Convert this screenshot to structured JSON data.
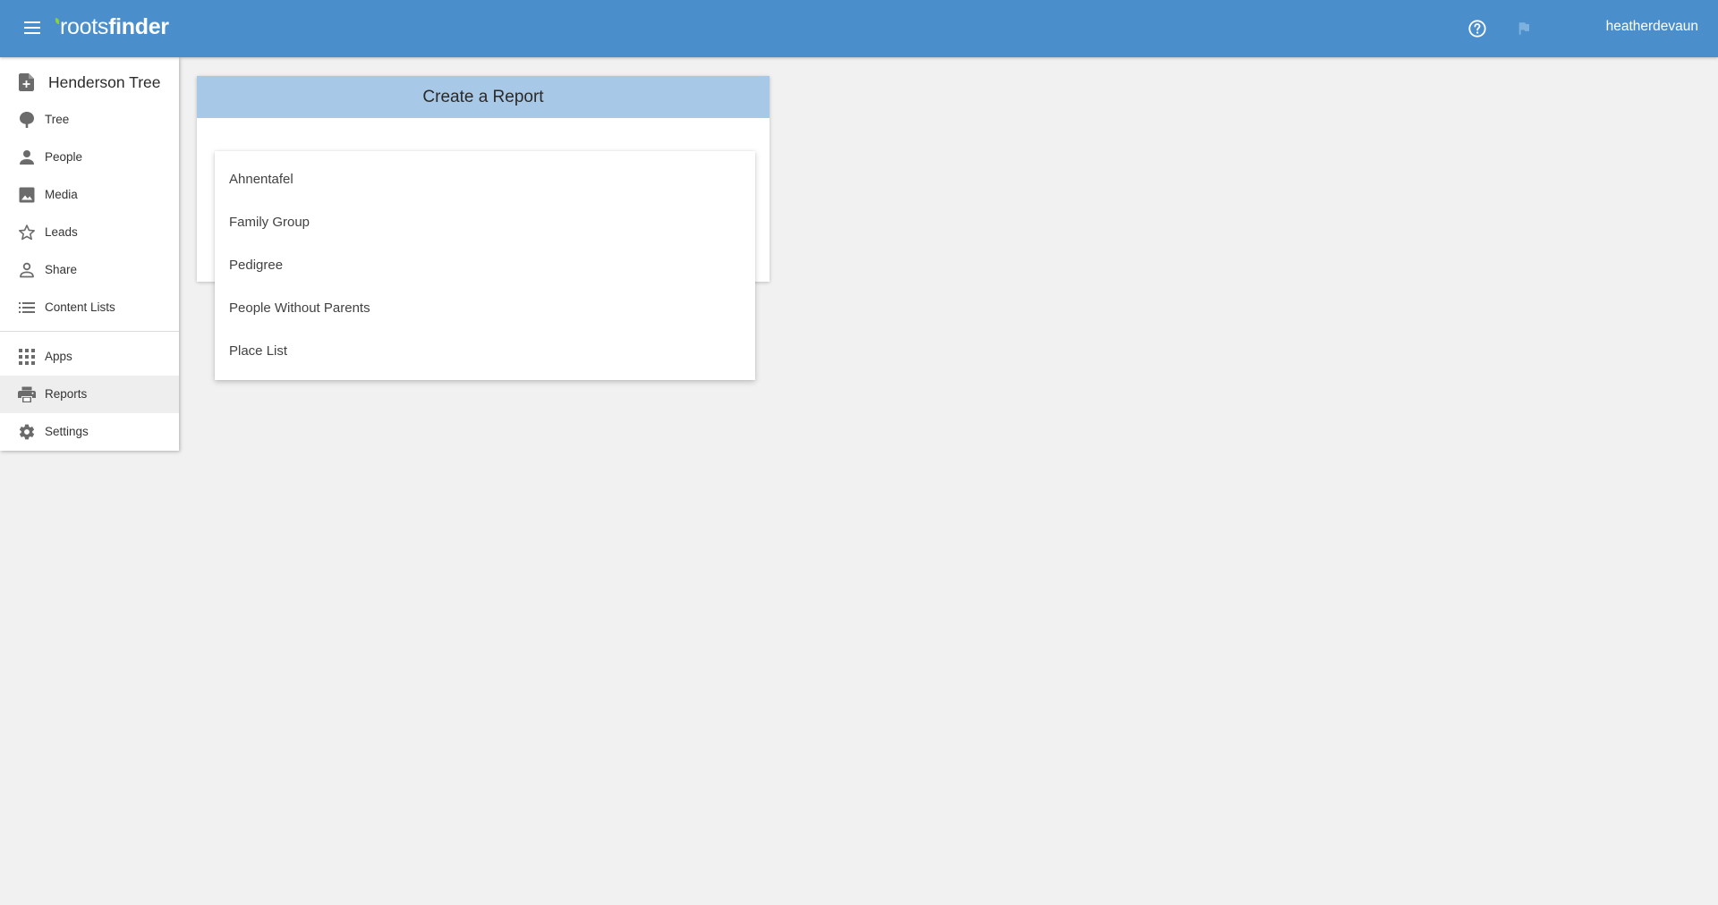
{
  "colors": {
    "appbar": "#4a8fcc",
    "card_header": "#a7c8e6",
    "page_background": "#f1f1f1",
    "active_nav": "#eeeeee",
    "logo_leaf": "#8bd13e"
  },
  "header": {
    "menu_icon": "hamburger-menu-icon",
    "logo": {
      "roots": "roots",
      "finder": "finder"
    },
    "help_icon": "help-circle-icon",
    "flag_icon": "flag-icon",
    "username": "heatherdevaun"
  },
  "sidebar": {
    "tree_title": "Henderson Tree",
    "tree_title_icon": "add-document-icon",
    "items": [
      {
        "label": "Tree",
        "icon": "tree-icon"
      },
      {
        "label": "People",
        "icon": "person-icon"
      },
      {
        "label": "Media",
        "icon": "image-icon"
      },
      {
        "label": "Leads",
        "icon": "star-outline-icon"
      },
      {
        "label": "Share",
        "icon": "person-outline-icon"
      },
      {
        "label": "Content Lists",
        "icon": "list-icon"
      },
      {
        "label": "Apps",
        "icon": "apps-grid-icon"
      },
      {
        "label": "Reports",
        "icon": "printer-icon",
        "active": true
      },
      {
        "label": "Settings",
        "icon": "gear-icon"
      }
    ]
  },
  "main": {
    "card_title": "Create a Report",
    "report_options": [
      "Ahnentafel",
      "Family Group",
      "Pedigree",
      "People Without Parents",
      "Place List"
    ]
  }
}
